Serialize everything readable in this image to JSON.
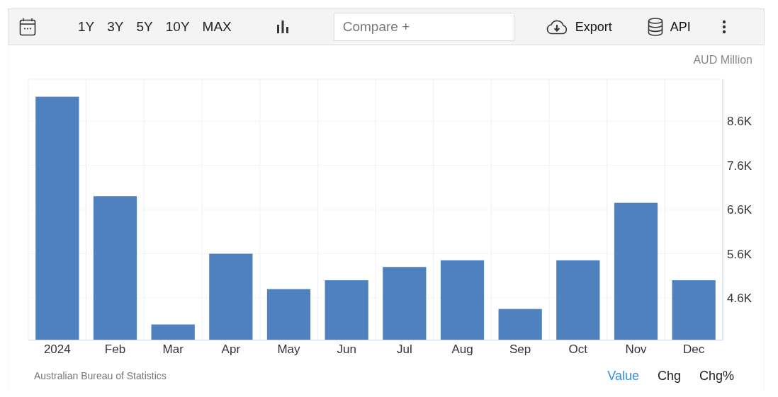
{
  "toolbar": {
    "ranges": [
      "1Y",
      "3Y",
      "5Y",
      "10Y",
      "MAX"
    ],
    "compare": {
      "placeholder": "Compare +"
    },
    "export": "Export",
    "api": "API"
  },
  "chart": {
    "unit": "AUD Million",
    "chart_data": {
      "type": "bar",
      "categories": [
        "2024",
        "Feb",
        "Mar",
        "Apr",
        "May",
        "Jun",
        "Jul",
        "Aug",
        "Sep",
        "Oct",
        "Nov",
        "Dec"
      ],
      "series": [
        {
          "color": "#4e81bd",
          "values": [
            9150,
            6900,
            4000,
            5600,
            4800,
            5000,
            5300,
            5450,
            4350,
            5450,
            6750,
            5000
          ]
        }
      ],
      "grid": true,
      "ylim": [
        3656,
        9544
      ],
      "yticks": [
        {
          "value": 4600,
          "label": "4.6K"
        },
        {
          "value": 5600,
          "label": "5.6K"
        },
        {
          "value": 6600,
          "label": "6.6K"
        },
        {
          "value": 7600,
          "label": "7.6K"
        },
        {
          "value": 8600,
          "label": "8.6K"
        }
      ]
    }
  },
  "footer": {
    "source": "Australian Bureau of Statistics",
    "modes": [
      {
        "label": "Value",
        "selected": true
      },
      {
        "label": "Chg",
        "selected": false
      },
      {
        "label": "Chg%",
        "selected": false
      }
    ]
  }
}
